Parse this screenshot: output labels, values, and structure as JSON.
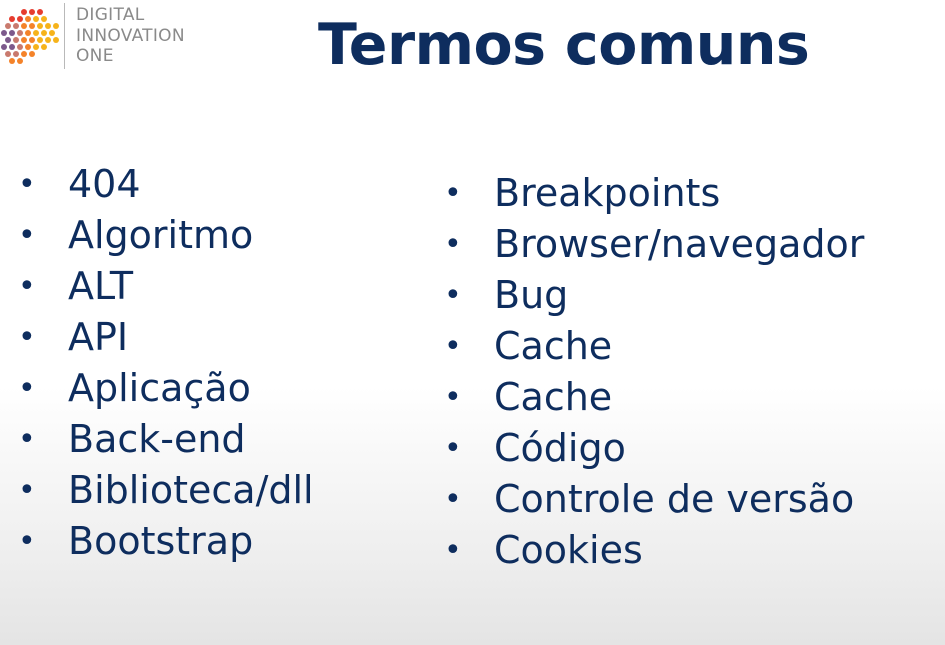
{
  "brand": {
    "name_lines": [
      "DIGITAL",
      "INNOVATION",
      "ONE"
    ],
    "logo_colors": [
      "#e63c2f",
      "#f4832a",
      "#f6b31b",
      "#c97a6e",
      "#7d5a8c"
    ]
  },
  "slide": {
    "title": "Termos comuns",
    "bullet": "•",
    "left_column": [
      "404",
      "Algoritmo",
      "ALT",
      "API",
      "Aplicação",
      "Back-end",
      "Biblioteca/dll",
      "Bootstrap"
    ],
    "right_column": [
      "Breakpoints",
      "Browser/navegador",
      "Bug",
      "Cache",
      "Cache",
      "Código",
      "Controle de versão",
      "Cookies"
    ]
  }
}
